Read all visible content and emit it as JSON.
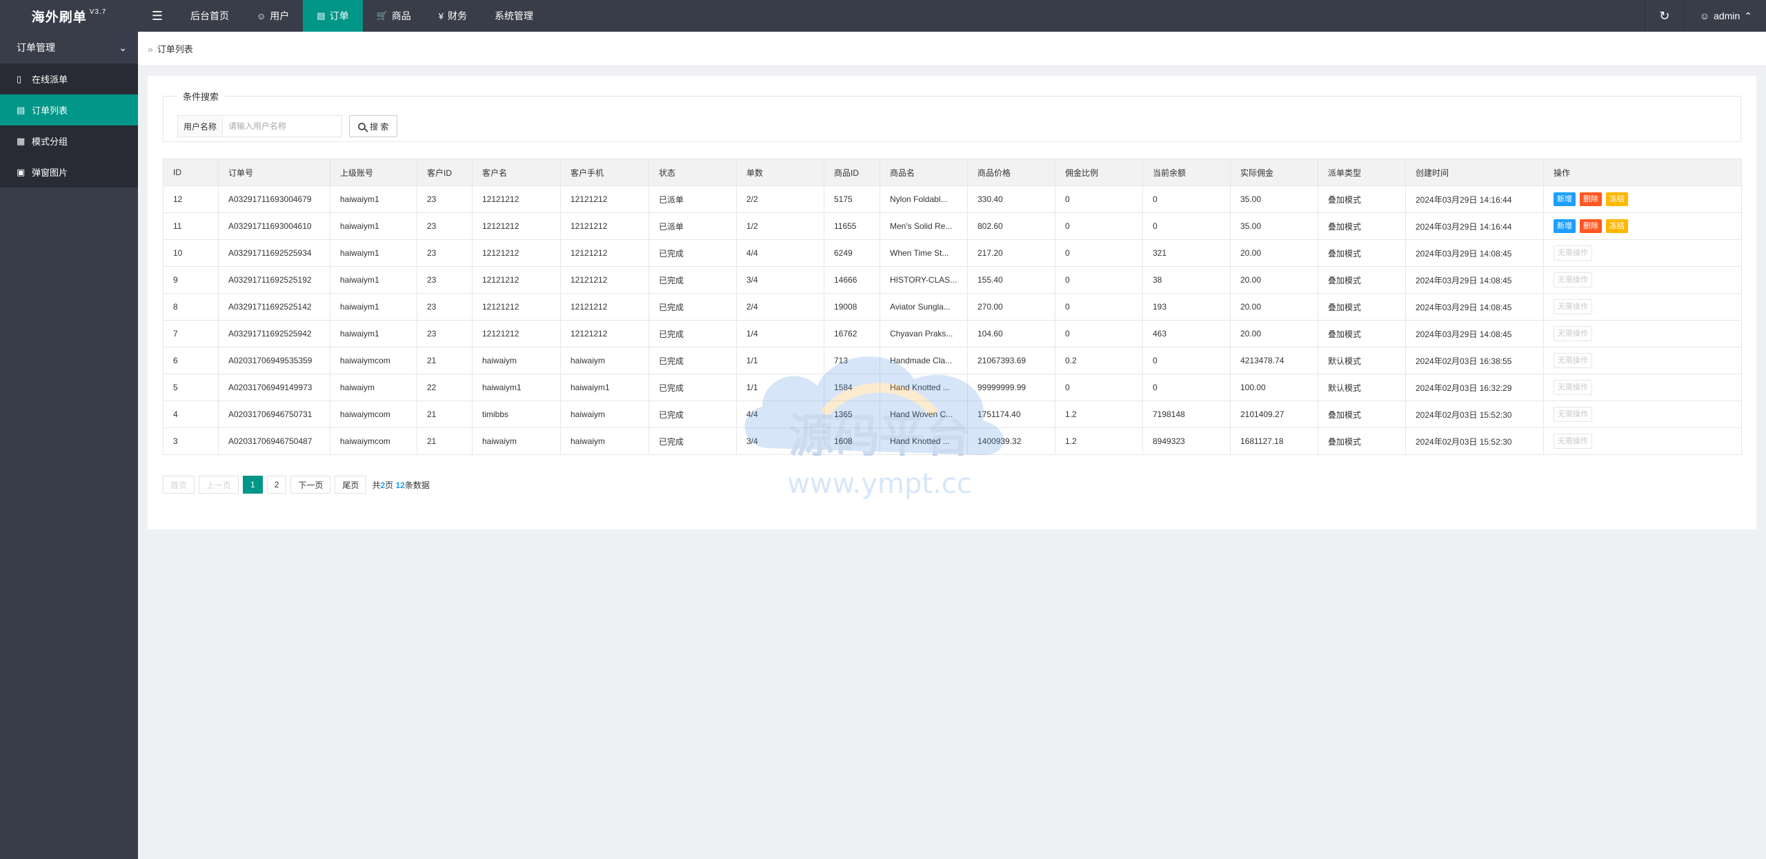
{
  "app": {
    "title": "海外刷单",
    "version": "V3.7"
  },
  "topnav": [
    {
      "label": "后台首页",
      "icon": "home-icon",
      "active": false
    },
    {
      "label": "用户",
      "icon": "user-icon",
      "active": false
    },
    {
      "label": "订单",
      "icon": "file-icon",
      "active": true
    },
    {
      "label": "商品",
      "icon": "cart-icon",
      "active": false
    },
    {
      "label": "财务",
      "icon": "yen-icon",
      "active": false
    },
    {
      "label": "系统管理",
      "icon": "",
      "active": false
    }
  ],
  "header": {
    "admin_label": "admin"
  },
  "sidebar": {
    "group_label": "订单管理",
    "items": [
      {
        "label": "在线派单",
        "icon": "document-icon",
        "active": false
      },
      {
        "label": "订单列表",
        "icon": "list-icon",
        "active": true
      },
      {
        "label": "模式分组",
        "icon": "group-icon",
        "active": false
      },
      {
        "label": "弹窗图片",
        "icon": "image-icon",
        "active": false
      }
    ]
  },
  "breadcrumb": {
    "current": "订单列表"
  },
  "search": {
    "legend": "条件搜索",
    "field_label": "用户名称",
    "placeholder": "请输入用户名称",
    "value": "",
    "button_label": "搜 索"
  },
  "table": {
    "columns": [
      "ID",
      "订单号",
      "上级账号",
      "客户ID",
      "客户名",
      "客户手机",
      "状态",
      "单数",
      "商品ID",
      "商品名",
      "商品价格",
      "佣金比例",
      "当前余额",
      "实际佣金",
      "派单类型",
      "创建时间",
      "操作"
    ],
    "rows": [
      {
        "id": "12",
        "order_no": "A03291711693004679",
        "parent": "haiwaiym1",
        "cust_id": "23",
        "cust_name": "12121212",
        "phone": "12121212",
        "status": "已派单",
        "status_kind": "purple",
        "count": "2/2",
        "goods_id": "5175",
        "goods_name": "Nylon Foldabl...",
        "price": "330.40",
        "rate": "0",
        "balance": "0",
        "commission": "35.00",
        "type": "叠加模式",
        "created": "2024年03月29日 14:16:44",
        "ops": "full"
      },
      {
        "id": "11",
        "order_no": "A03291711693004610",
        "parent": "haiwaiym1",
        "cust_id": "23",
        "cust_name": "12121212",
        "phone": "12121212",
        "status": "已派单",
        "status_kind": "purple",
        "count": "1/2",
        "goods_id": "11655",
        "goods_name": "Men's Solid Re...",
        "price": "802.60",
        "rate": "0",
        "balance": "0",
        "commission": "35.00",
        "type": "叠加模式",
        "created": "2024年03月29日 14:16:44",
        "ops": "full"
      },
      {
        "id": "10",
        "order_no": "A03291711692525934",
        "parent": "haiwaiym1",
        "cust_id": "23",
        "cust_name": "12121212",
        "phone": "12121212",
        "status": "已完成",
        "status_kind": "green",
        "count": "4/4",
        "goods_id": "6249",
        "goods_name": "When Time St...",
        "price": "217.20",
        "rate": "0",
        "balance": "321",
        "commission": "20.00",
        "type": "叠加模式",
        "created": "2024年03月29日 14:08:45",
        "ops": "none"
      },
      {
        "id": "9",
        "order_no": "A03291711692525192",
        "parent": "haiwaiym1",
        "cust_id": "23",
        "cust_name": "12121212",
        "phone": "12121212",
        "status": "已完成",
        "status_kind": "green",
        "count": "3/4",
        "goods_id": "14666",
        "goods_name": "HISTORY-CLAS...",
        "price": "155.40",
        "rate": "0",
        "balance": "38",
        "commission": "20.00",
        "type": "叠加模式",
        "created": "2024年03月29日 14:08:45",
        "ops": "none"
      },
      {
        "id": "8",
        "order_no": "A03291711692525142",
        "parent": "haiwaiym1",
        "cust_id": "23",
        "cust_name": "12121212",
        "phone": "12121212",
        "status": "已完成",
        "status_kind": "green",
        "count": "2/4",
        "goods_id": "19008",
        "goods_name": "Aviator Sungla...",
        "price": "270.00",
        "rate": "0",
        "balance": "193",
        "commission": "20.00",
        "type": "叠加模式",
        "created": "2024年03月29日 14:08:45",
        "ops": "none"
      },
      {
        "id": "7",
        "order_no": "A03291711692525942",
        "parent": "haiwaiym1",
        "cust_id": "23",
        "cust_name": "12121212",
        "phone": "12121212",
        "status": "已完成",
        "status_kind": "green",
        "count": "1/4",
        "goods_id": "16762",
        "goods_name": "Chyavan Praks...",
        "price": "104.60",
        "rate": "0",
        "balance": "463",
        "commission": "20.00",
        "type": "叠加模式",
        "created": "2024年03月29日 14:08:45",
        "ops": "none"
      },
      {
        "id": "6",
        "order_no": "A02031706949535359",
        "parent": "haiwaiymcom",
        "cust_id": "21",
        "cust_name": "haiwaiym",
        "phone": "haiwaiym",
        "status": "已完成",
        "status_kind": "green",
        "count": "1/1",
        "goods_id": "713",
        "goods_name": "Handmade Cla...",
        "price": "21067393.69",
        "rate": "0.2",
        "balance": "0",
        "commission": "4213478.74",
        "type": "默认模式",
        "created": "2024年02月03日 16:38:55",
        "ops": "none"
      },
      {
        "id": "5",
        "order_no": "A02031706949149973",
        "parent": "haiwaiym",
        "cust_id": "22",
        "cust_name": "haiwaiym1",
        "phone": "haiwaiym1",
        "status": "已完成",
        "status_kind": "green",
        "count": "1/1",
        "goods_id": "1584",
        "goods_name": "Hand Knotted ...",
        "price": "99999999.99",
        "rate": "0",
        "balance": "0",
        "commission": "100.00",
        "type": "默认模式",
        "created": "2024年02月03日 16:32:29",
        "ops": "none"
      },
      {
        "id": "4",
        "order_no": "A02031706946750731",
        "parent": "haiwaiymcom",
        "cust_id": "21",
        "cust_name": "timibbs",
        "phone": "haiwaiym",
        "status": "已完成",
        "status_kind": "green",
        "count": "4/4",
        "goods_id": "1365",
        "goods_name": "Hand Woven C...",
        "price": "1751174.40",
        "rate": "1.2",
        "balance": "7198148",
        "commission": "2101409.27",
        "type": "叠加模式",
        "created": "2024年02月03日 15:52:30",
        "ops": "none"
      },
      {
        "id": "3",
        "order_no": "A02031706946750487",
        "parent": "haiwaiymcom",
        "cust_id": "21",
        "cust_name": "haiwaiym",
        "phone": "haiwaiym",
        "status": "已完成",
        "status_kind": "green",
        "count": "3/4",
        "goods_id": "1608",
        "goods_name": "Hand Knotted ...",
        "price": "1400939.32",
        "rate": "1.2",
        "balance": "8949323",
        "commission": "1681127.18",
        "type": "叠加模式",
        "created": "2024年02月03日 15:52:30",
        "ops": "none"
      }
    ],
    "op_labels": {
      "add": "新增",
      "delete": "删除",
      "freeze": "冻结",
      "none": "无需操作"
    }
  },
  "pagination": {
    "first": "首页",
    "prev": "上一页",
    "pages": [
      "1",
      "2"
    ],
    "current": "1",
    "next": "下一页",
    "last": "尾页",
    "count_prefix": "共",
    "total_pages": "2",
    "pages_suffix": "页",
    "total_rows": "12",
    "rows_suffix": "条数据"
  },
  "watermark": {
    "title": "源码平台",
    "url": "www.ympt.cc"
  },
  "colors": {
    "accent": "#009688",
    "header": "#393d49",
    "blue": "#1e9fff",
    "red": "#ff5722",
    "yellow": "#ffb800",
    "purple": "#a233c6",
    "green": "#5fb878"
  }
}
